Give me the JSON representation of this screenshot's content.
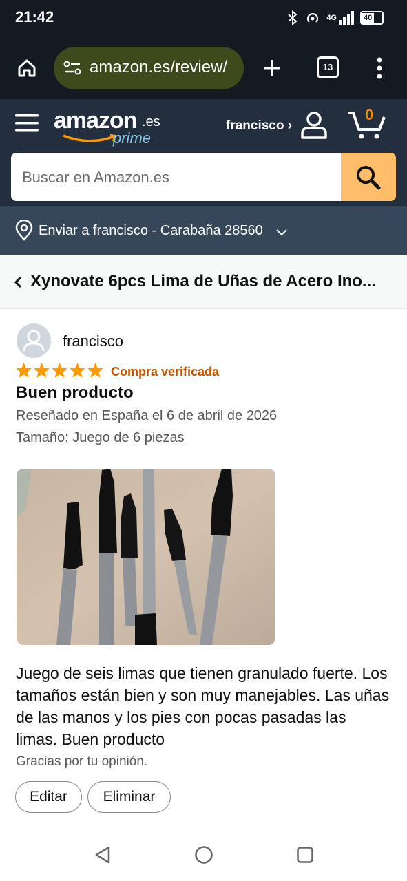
{
  "status_bar": {
    "time": "21:42",
    "battery": "40",
    "network": "4G"
  },
  "browser": {
    "url": "amazon.es/review/",
    "tab_count": "13"
  },
  "header": {
    "logo": "amazon",
    "logo_tld": ".es",
    "logo_prime": "prime",
    "account_label": "francisco ›",
    "cart_count": "0",
    "search_placeholder": "Buscar en Amazon.es",
    "deliver_to": "Enviar a francisco - Carabaña 28560"
  },
  "product": {
    "title": "Xynovate 6pcs Lima de Uñas de Acero Ino..."
  },
  "review": {
    "author": "francisco",
    "rating": 5,
    "verified": "Compra verificada",
    "headline": "Buen producto",
    "date": "Reseñado en España el 6 de abril de 2026",
    "variant": "Tamaño: Juego de 6 piezas",
    "body": "Juego de seis limas que tienen granulado fuerte. Los tamaños están bien y son muy manejables. Las uñas de las manos y los pies con pocas pasadas las limas. Buen producto",
    "thanks": "Gracias por tu opinión.",
    "edit_label": "Editar",
    "delete_label": "Eliminar"
  },
  "colors": {
    "header_dark": "#131a22",
    "amazon_navy": "#232f3e",
    "deliver_bar": "#37475a",
    "search_button": "#febd69",
    "cart_orange": "#f08804",
    "star": "#ff9900",
    "verified": "#c45500"
  }
}
